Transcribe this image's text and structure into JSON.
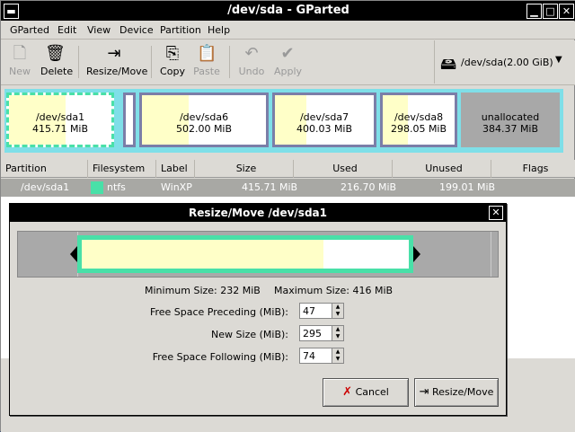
{
  "window": {
    "title": "/dev/sda - GParted"
  },
  "menu": [
    "GParted",
    "Edit",
    "View",
    "Device",
    "Partition",
    "Help"
  ],
  "toolbar": {
    "new": "New",
    "delete": "Delete",
    "resize": "Resize/Move",
    "copy": "Copy",
    "paste": "Paste",
    "undo": "Undo",
    "apply": "Apply"
  },
  "device": {
    "name": "/dev/sda",
    "size": "(2.00 GiB)"
  },
  "diskmap": [
    {
      "name": "/dev/sda1",
      "size": "415.71 MiB"
    },
    {
      "name": "/dev/sda6",
      "size": "502.00 MiB"
    },
    {
      "name": "/dev/sda7",
      "size": "400.03 MiB"
    },
    {
      "name": "/dev/sda8",
      "size": "298.05 MiB"
    },
    {
      "name": "unallocated",
      "size": "384.37 MiB"
    }
  ],
  "table": {
    "headers": [
      "Partition",
      "Filesystem",
      "Label",
      "Size",
      "Used",
      "Unused",
      "Flags"
    ],
    "row1": {
      "partition": "/dev/sda1",
      "filesystem": "ntfs",
      "label": "WinXP",
      "size": "415.71 MiB",
      "used": "216.70 MiB",
      "unused": "199.01 MiB",
      "flags": ""
    }
  },
  "dialog": {
    "title": "Resize/Move /dev/sda1",
    "min_size": "Minimum Size: 232 MiB",
    "max_size": "Maximum Size: 416 MiB",
    "preceding_label": "Free Space Preceding (MiB):",
    "preceding_value": "47",
    "newsize_label": "New Size (MiB):",
    "newsize_value": "295",
    "following_label": "Free Space Following (MiB):",
    "following_value": "74",
    "cancel": "Cancel",
    "resize": "Resize/Move"
  },
  "colors": {
    "ntfs": "#49e0a8",
    "used": "#ffffc8",
    "border": "#7fdfe8"
  }
}
